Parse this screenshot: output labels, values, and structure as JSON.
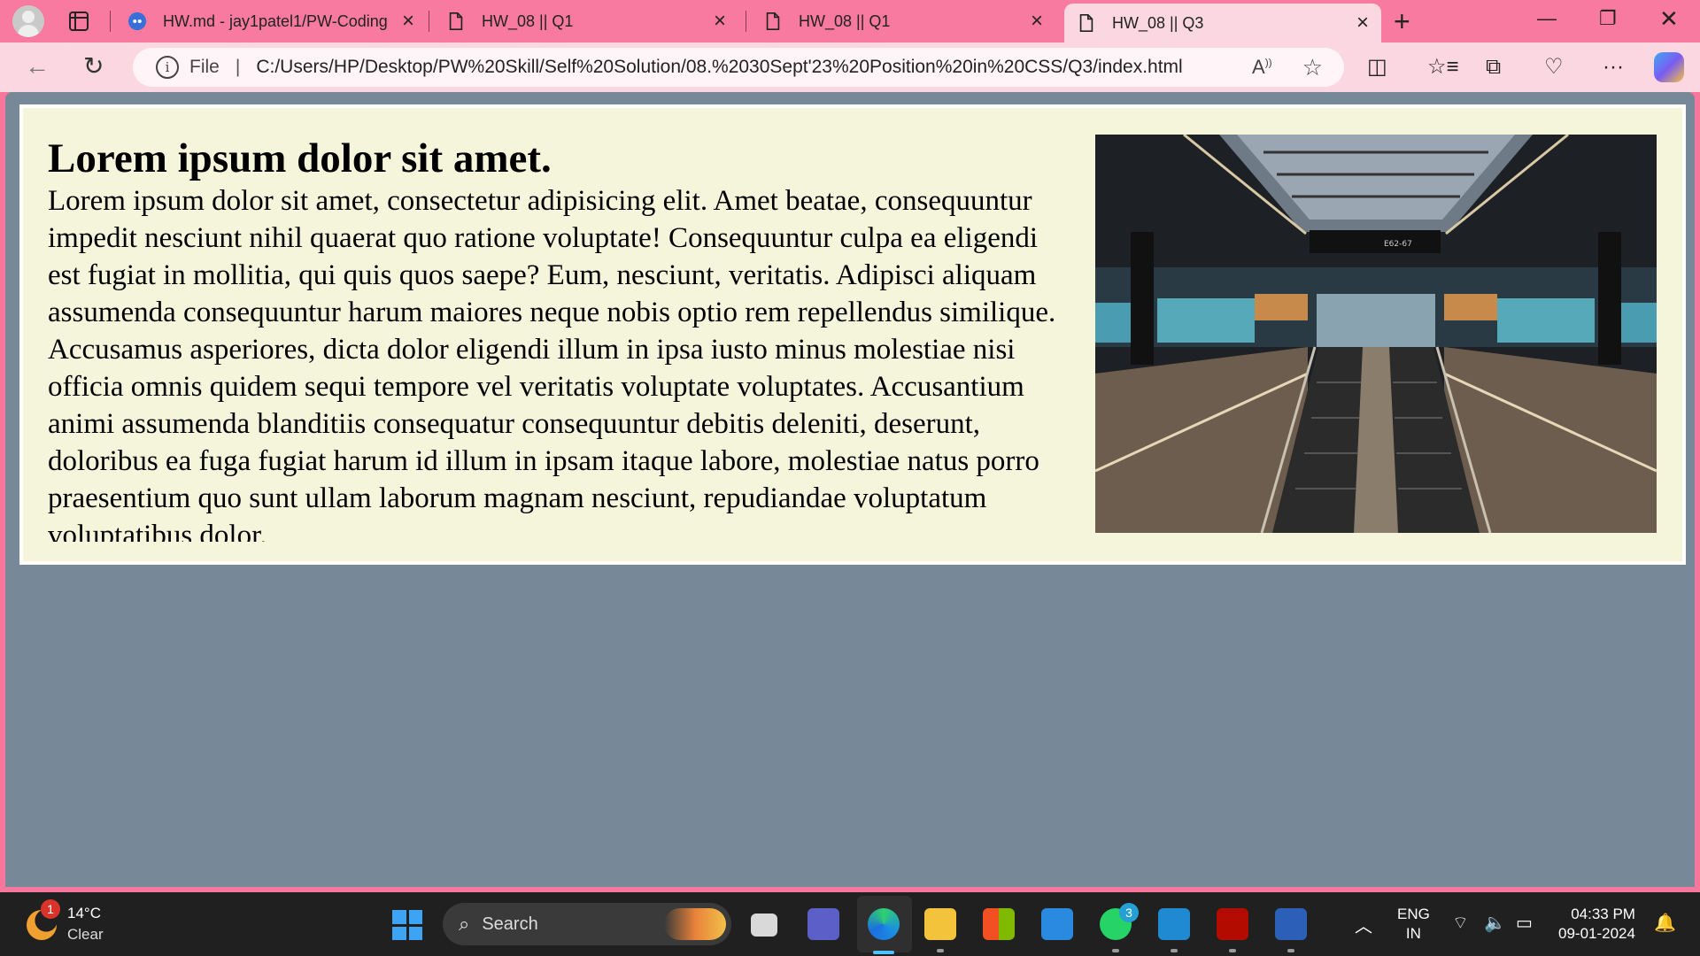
{
  "browser": {
    "tabs": [
      {
        "title": "HW.md - jay1patel1/PW-Coding",
        "favicon": "github-icon",
        "active": false
      },
      {
        "title": "HW_08 || Q1",
        "favicon": "page-icon",
        "active": false
      },
      {
        "title": "HW_08 || Q1",
        "favicon": "page-icon",
        "active": false
      },
      {
        "title": "HW_08 || Q3",
        "favicon": "page-icon",
        "active": true
      }
    ],
    "address": {
      "scheme_label": "File",
      "url": "C:/Users/HP/Desktop/PW%20Skill/Self%20Solution/08.%2030Sept'23%20Position%20in%20CSS/Q3/index.html",
      "read_aloud_label": "A)"
    },
    "accent": "#f87aa0"
  },
  "page": {
    "heading": "Lorem ipsum dolor sit amet.",
    "paragraph": "Lorem ipsum dolor sit amet, consectetur adipisicing elit. Amet beatae, consequuntur impedit nesciunt nihil quaerat quo ratione voluptate! Consequuntur culpa ea eligendi est fugiat in mollitia, qui quis quos saepe? Eum, nesciunt, veritatis. Adipisci aliquam assumenda consequuntur harum maiores neque nobis optio rem repellendus similique. Accusamus asperiores, dicta dolor eligendi illum in ipsa iusto minus molestiae nisi officia omnis quidem sequi tempore vel veritatis voluptate voluptates. Accusantium animi assumenda blanditiis consequatur consequuntur debitis deleniti, deserunt, doloribus ea fuga fugiat harum id illum in ipsam itaque labore, molestiae natus porro praesentium quo sunt ullam laborum magnam nesciunt, repudiandae voluptatum voluptatibus dolor.",
    "image_sign": "E62-67",
    "background": "#778899",
    "container_background": "#f5f5dc"
  },
  "taskbar": {
    "weather": {
      "temp": "14°C",
      "condition": "Clear",
      "badge": "1"
    },
    "search_placeholder": "Search",
    "whatsapp_badge": "3",
    "language": {
      "line1": "ENG",
      "line2": "IN"
    },
    "clock": {
      "time": "04:33 PM",
      "date": "09-01-2024"
    }
  }
}
